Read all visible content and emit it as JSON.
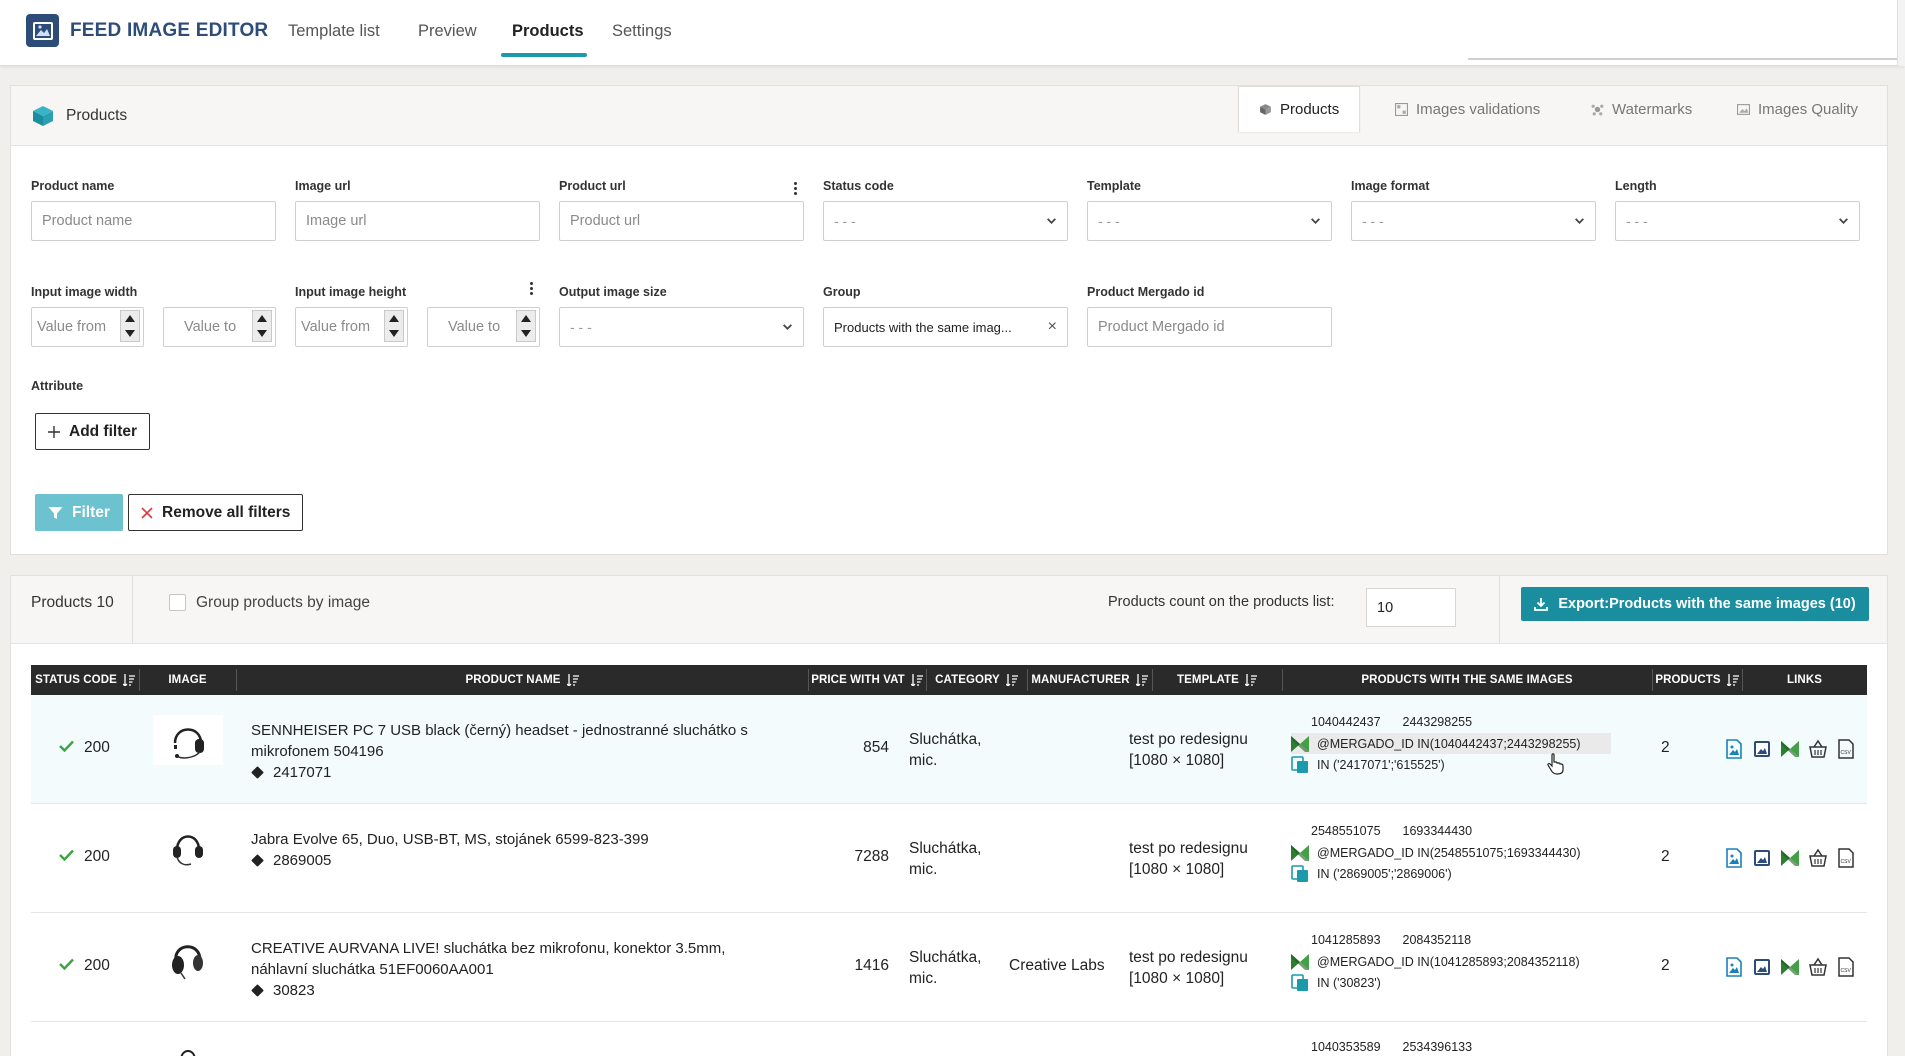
{
  "app": {
    "title": "FEED IMAGE EDITOR"
  },
  "nav": {
    "tabs": [
      "Template list",
      "Preview",
      "Products",
      "Settings"
    ],
    "active": "Products"
  },
  "filters_card": {
    "title": "Products",
    "tabs": [
      "Products",
      "Images validations",
      "Watermarks",
      "Images Quality"
    ],
    "active_tab": "Products",
    "fields": {
      "product_name": {
        "label": "Product name",
        "placeholder": "Product name"
      },
      "image_url": {
        "label": "Image url",
        "placeholder": "Image url"
      },
      "product_url": {
        "label": "Product url",
        "placeholder": "Product url"
      },
      "status_code": {
        "label": "Status code",
        "value": "- - -"
      },
      "template": {
        "label": "Template",
        "value": "- - -"
      },
      "image_format": {
        "label": "Image format",
        "value": "- - -"
      },
      "length": {
        "label": "Length",
        "value": "- - -"
      },
      "input_image_width": {
        "label": "Input image width",
        "from_placeholder": "Value from",
        "to_placeholder": "Value to"
      },
      "input_image_height": {
        "label": "Input image height",
        "from_placeholder": "Value from",
        "to_placeholder": "Value to"
      },
      "output_image_size": {
        "label": "Output image size",
        "value": "- - -"
      },
      "group": {
        "label": "Group",
        "value": "Products with the same imag..."
      },
      "product_mergado_id": {
        "label": "Product Mergado id",
        "placeholder": "Product Mergado id"
      },
      "attribute": {
        "label": "Attribute"
      }
    },
    "buttons": {
      "add_filter": "Add filter",
      "filter": "Filter",
      "remove_all": "Remove all filters"
    }
  },
  "products_card": {
    "count_label": "Products 10",
    "group_by_image": "Group products by image",
    "count_on_list_label": "Products count on the products list:",
    "count_on_list_value": "10",
    "export_button": "Export:Products with the same images (10)"
  },
  "table": {
    "headers": [
      "STATUS CODE",
      "IMAGE",
      "PRODUCT NAME",
      "PRICE WITH VAT",
      "CATEGORY",
      "MANUFACTURER",
      "TEMPLATE",
      "PRODUCTS WITH THE SAME IMAGES",
      "PRODUCTS",
      "LINKS"
    ],
    "rows": [
      {
        "status": "200",
        "name": "SENNHEISER PC 7 USB black (černý) headset - jednostranné sluchátko s mikrofonem 504196",
        "id": "2417071",
        "price": "854",
        "category_1": "Sluchátka,",
        "category_2": "mic.",
        "manufacturer": "",
        "template_1": "test po redesignu",
        "template_2": "[1080 × 1080]",
        "same_id_1": "1040442437",
        "same_id_2": "2443298255",
        "same_query": "@MERGADO_ID IN(1040442437;2443298255)",
        "same_in": "IN ('2417071';'615525')",
        "products": "2"
      },
      {
        "status": "200",
        "name": "Jabra Evolve 65, Duo, USB-BT, MS, stojánek 6599-823-399",
        "id": "2869005",
        "price": "7288",
        "category_1": "Sluchátka,",
        "category_2": "mic.",
        "manufacturer": "",
        "template_1": "test po redesignu",
        "template_2": "[1080 × 1080]",
        "same_id_1": "2548551075",
        "same_id_2": "1693344430",
        "same_query": "@MERGADO_ID IN(2548551075;1693344430)",
        "same_in": "IN ('2869005';'2869006')",
        "products": "2"
      },
      {
        "status": "200",
        "name": "CREATIVE AURVANA LIVE! sluchátka bez mikrofonu, konektor 3.5mm, náhlavní sluchátka 51EF0060AA001",
        "id": "30823",
        "price": "1416",
        "category_1": "Sluchátka,",
        "category_2": "mic.",
        "manufacturer": "Creative Labs",
        "template_1": "test po redesignu",
        "template_2": "[1080 × 1080]",
        "same_id_1": "1041285893",
        "same_id_2": "2084352118",
        "same_query": "@MERGADO_ID IN(1041285893;2084352118)",
        "same_in": "IN ('30823')",
        "products": "2"
      },
      {
        "same_id_1": "1040353589",
        "same_id_2": "2534396133"
      }
    ]
  },
  "colors": {
    "brand": "#2d4c78",
    "accent": "#1a9aab",
    "export": "#1a8e9f",
    "filter_btn": "#6cc2cf",
    "ok": "#3aa541",
    "mergado": "#2ea44f",
    "links": "#1a82b8"
  }
}
